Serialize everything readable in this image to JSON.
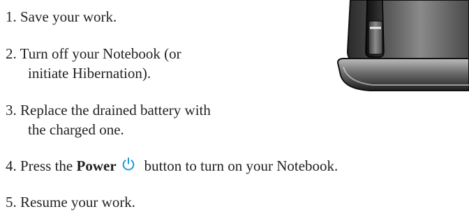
{
  "steps": [
    {
      "number": "1.",
      "line1": "Save your work."
    },
    {
      "number": "2.",
      "line1": "Turn off your Notebook (or",
      "line2": "initiate Hibernation)."
    },
    {
      "number": "3.",
      "line1": "Replace the drained battery with",
      "line2": "the charged one."
    },
    {
      "number": "4.",
      "before": "Press the ",
      "bold": "Power",
      "after": "button to turn on your Notebook."
    },
    {
      "number": "5.",
      "line1": "Resume your work."
    }
  ],
  "icons": {
    "power": "power-icon",
    "illustration": "battery-release-switch-illustration"
  },
  "colors": {
    "power_icon": "#1a9ad6",
    "text": "#222222"
  }
}
